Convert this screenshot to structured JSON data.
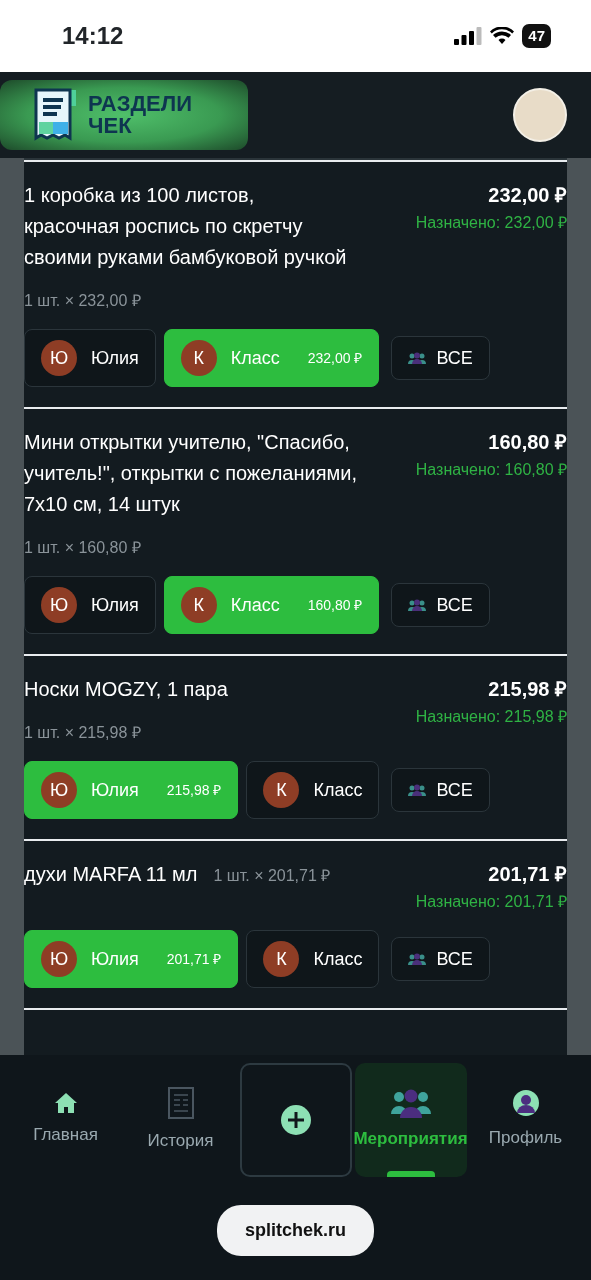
{
  "status_bar": {
    "time": "14:12",
    "battery": "47"
  },
  "header": {
    "logo_text": "РАЗДЕЛИ ЧЕК"
  },
  "items": [
    {
      "kind": "stacked",
      "name": "1 коробка из 100 листов, красочная роспись по скретчу своими руками бамбуковой ручкой",
      "price": "232,00 ₽",
      "assigned": "Назначено: 232,00 ₽",
      "quantity": "1 шт. × 232,00 ₽",
      "participants": [
        {
          "initial": "Ю",
          "name": "Юлия",
          "selected": false
        },
        {
          "initial": "К",
          "name": "Класс",
          "selected": true,
          "amount": "232,00 ₽"
        }
      ],
      "all_label": "ВСЕ"
    },
    {
      "kind": "stacked",
      "name": "Мини открытки учителю, \"Спасибо, учитель!\", открытки с пожеланиями, 7х10 см, 14 штук",
      "price": "160,80 ₽",
      "assigned": "Назначено: 160,80 ₽",
      "quantity": "1 шт. × 160,80 ₽",
      "participants": [
        {
          "initial": "Ю",
          "name": "Юлия",
          "selected": false
        },
        {
          "initial": "К",
          "name": "Класс",
          "selected": true,
          "amount": "160,80 ₽"
        }
      ],
      "all_label": "ВСЕ"
    },
    {
      "kind": "stacked",
      "name": "Носки MOGZY, 1 пара",
      "price": "215,98 ₽",
      "assigned": "Назначено: 215,98 ₽",
      "quantity": "1 шт. × 215,98 ₽",
      "participants": [
        {
          "initial": "Ю",
          "name": "Юлия",
          "selected": true,
          "amount": "215,98 ₽"
        },
        {
          "initial": "К",
          "name": "Класс",
          "selected": false
        }
      ],
      "all_label": "ВСЕ"
    },
    {
      "kind": "inline",
      "name": "духи MARFA 11 мл",
      "price": "201,71 ₽",
      "assigned": "Назначено: 201,71 ₽",
      "quantity": "1 шт. × 201,71 ₽",
      "participants": [
        {
          "initial": "Ю",
          "name": "Юлия",
          "selected": true,
          "amount": "201,71 ₽"
        },
        {
          "initial": "К",
          "name": "Класс",
          "selected": false
        }
      ],
      "all_label": "ВСЕ"
    }
  ],
  "bottom_nav": [
    {
      "kind": "home",
      "label": "Главная",
      "selected": false
    },
    {
      "kind": "history",
      "label": "История",
      "selected": false
    },
    {
      "kind": "add",
      "selected": false
    },
    {
      "kind": "events",
      "label": "Мероприятия",
      "selected": true
    },
    {
      "kind": "profile",
      "label": "Профиль",
      "selected": false
    }
  ],
  "url_bar": {
    "url": "splitchek.ru"
  }
}
